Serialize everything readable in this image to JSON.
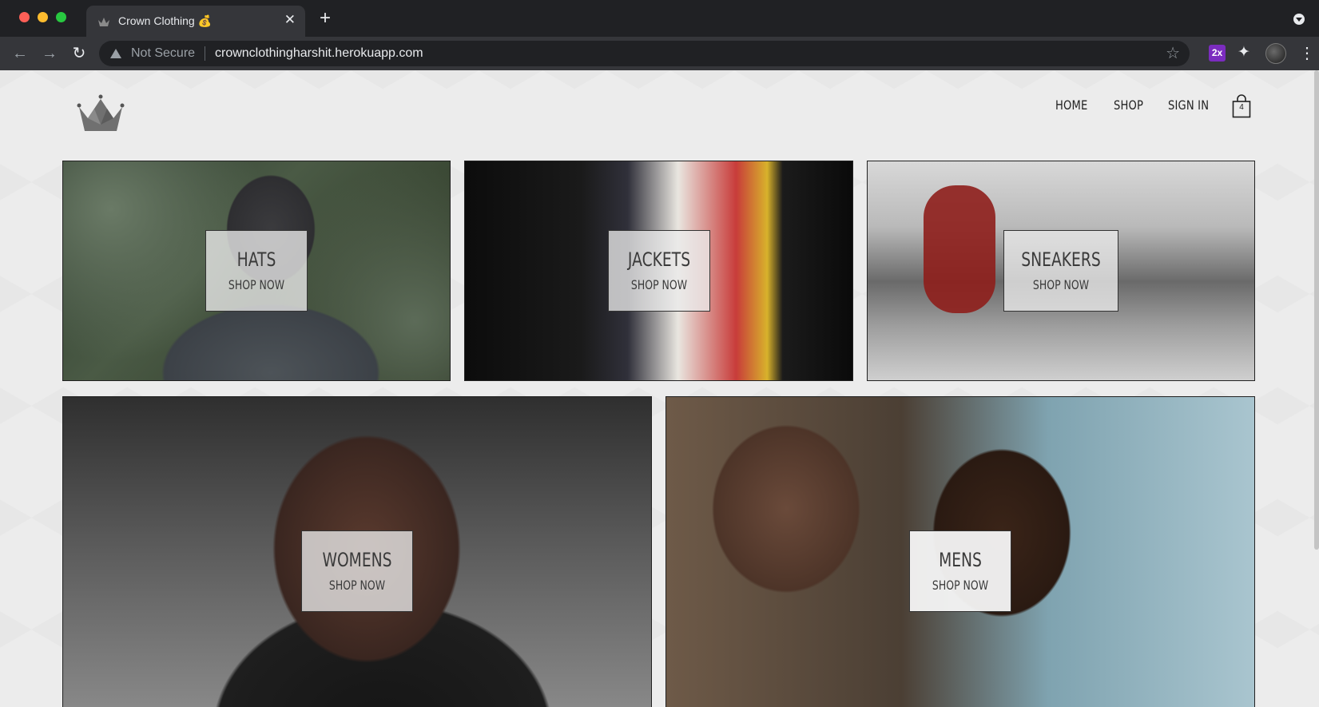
{
  "browser": {
    "tab_title": "Crown Clothing 💰",
    "tab_close": "✕",
    "new_tab": "+",
    "security_label": "Not Secure",
    "url": "crownclothingharshit.herokuapp.com",
    "extension_badge": "2x"
  },
  "header": {
    "nav": {
      "home": "HOME",
      "shop": "SHOP",
      "sign_in": "SIGN IN"
    },
    "cart_count": "4"
  },
  "directory": {
    "items": [
      {
        "title": "HATS",
        "subtitle": "SHOP NOW"
      },
      {
        "title": "JACKETS",
        "subtitle": "SHOP NOW"
      },
      {
        "title": "SNEAKERS",
        "subtitle": "SHOP NOW"
      },
      {
        "title": "WOMENS",
        "subtitle": "SHOP NOW"
      },
      {
        "title": "MENS",
        "subtitle": "SHOP NOW"
      }
    ]
  }
}
